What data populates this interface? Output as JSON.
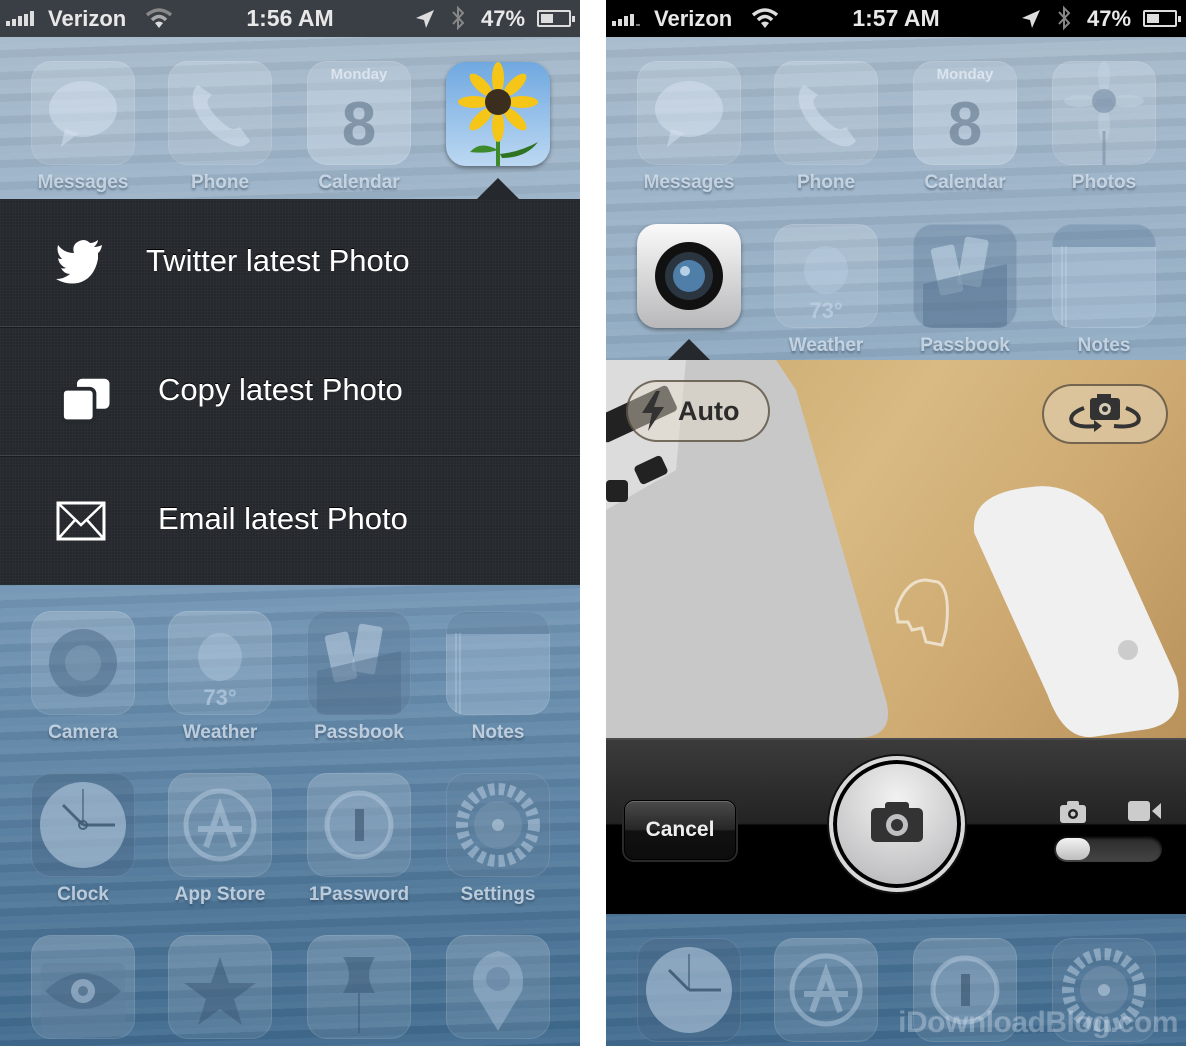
{
  "left_screen": {
    "status_bar": {
      "carrier": "Verizon",
      "time": "1:56 AM",
      "battery_percent": "47%",
      "battery_level": 0.47,
      "signal_bars": 5
    },
    "top_row_apps": [
      {
        "label": "Messages",
        "icon": "messages-icon"
      },
      {
        "label": "Phone",
        "icon": "phone-icon"
      },
      {
        "label": "Calendar",
        "icon": "calendar-icon",
        "day": "Monday",
        "date": "8"
      },
      {
        "label": "Photos",
        "icon": "photos-icon",
        "active": true
      }
    ],
    "popover_menu": [
      {
        "label": "Twitter latest Photo",
        "icon": "twitter-bird-icon"
      },
      {
        "label": "Copy latest Photo",
        "icon": "copy-icon"
      },
      {
        "label": "Email latest Photo",
        "icon": "envelope-icon"
      }
    ],
    "row_2_apps": [
      {
        "label": "Camera",
        "icon": "camera-icon"
      },
      {
        "label": "Weather",
        "icon": "weather-icon",
        "temp": "73°"
      },
      {
        "label": "Passbook",
        "icon": "passbook-icon"
      },
      {
        "label": "Notes",
        "icon": "notes-icon"
      }
    ],
    "row_3_apps": [
      {
        "label": "Clock",
        "icon": "clock-icon"
      },
      {
        "label": "App Store",
        "icon": "app-store-icon"
      },
      {
        "label": "1Password",
        "icon": "1password-icon"
      },
      {
        "label": "Settings",
        "icon": "settings-gear-icon"
      }
    ],
    "row_4_apps": [
      {
        "icon": "eye-folder-icon"
      },
      {
        "icon": "star-icon"
      },
      {
        "icon": "pushpin-icon"
      },
      {
        "icon": "map-pin-icon"
      }
    ]
  },
  "right_screen": {
    "status_bar": {
      "carrier": "Verizon",
      "time": "1:57 AM",
      "battery_percent": "47%",
      "battery_level": 0.47,
      "signal_bars": 4
    },
    "top_row_apps": [
      {
        "label": "Messages",
        "icon": "messages-icon"
      },
      {
        "label": "Phone",
        "icon": "phone-icon"
      },
      {
        "label": "Calendar",
        "icon": "calendar-icon",
        "day": "Monday",
        "date": "8"
      },
      {
        "label": "Photos",
        "icon": "photos-icon"
      }
    ],
    "row_2_apps": [
      {
        "label": "Camera",
        "icon": "camera-icon",
        "active": true
      },
      {
        "label": "Weather",
        "icon": "weather-icon",
        "temp": "73°"
      },
      {
        "label": "Passbook",
        "icon": "passbook-icon"
      },
      {
        "label": "Notes",
        "icon": "notes-icon"
      }
    ],
    "camera": {
      "flash_label": "Auto",
      "cancel_label": "Cancel",
      "mode": "photo"
    },
    "bottom_row_apps": [
      {
        "icon": "clock-icon"
      },
      {
        "icon": "app-store-icon"
      },
      {
        "icon": "1password-icon"
      },
      {
        "icon": "settings-gear-icon"
      }
    ],
    "watermark": "iDownloadBlog.com"
  }
}
